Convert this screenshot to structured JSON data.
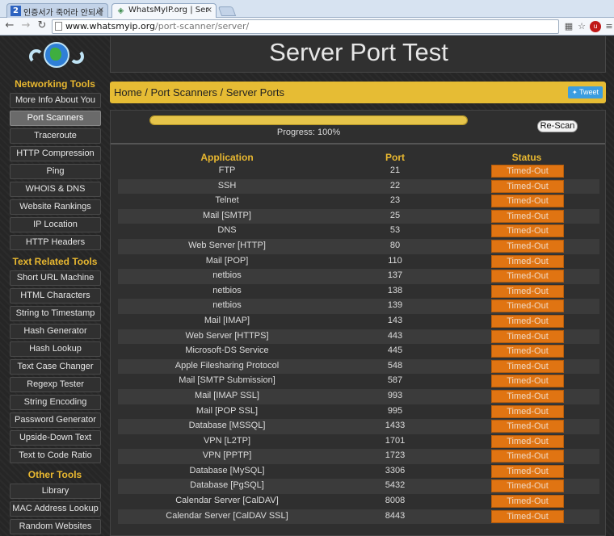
{
  "browser": {
    "tabs": [
      {
        "label": "인증서가 죽어라 안되세",
        "icon": "2",
        "active": false
      },
      {
        "label": "WhatsMyIP.org | Ser",
        "icon": "◈",
        "active": true
      }
    ],
    "url_host": "www.whatsmyip.org",
    "url_path": "/port-scanner/server/",
    "close_glyph": "×"
  },
  "sidebar": {
    "sections": [
      {
        "heading": "Networking Tools",
        "items": [
          {
            "label": "More Info About You",
            "active": false
          },
          {
            "label": "Port Scanners",
            "active": true
          },
          {
            "label": "Traceroute",
            "active": false
          },
          {
            "label": "HTTP Compression",
            "active": false
          },
          {
            "label": "Ping",
            "active": false
          },
          {
            "label": "WHOIS & DNS",
            "active": false
          },
          {
            "label": "Website Rankings",
            "active": false
          },
          {
            "label": "IP Location",
            "active": false
          },
          {
            "label": "HTTP Headers",
            "active": false
          }
        ]
      },
      {
        "heading": "Text Related Tools",
        "items": [
          {
            "label": "Short URL Machine",
            "active": false
          },
          {
            "label": "HTML Characters",
            "active": false
          },
          {
            "label": "String to Timestamp",
            "active": false
          },
          {
            "label": "Hash Generator",
            "active": false
          },
          {
            "label": "Hash Lookup",
            "active": false
          },
          {
            "label": "Text Case Changer",
            "active": false
          },
          {
            "label": "Regexp Tester",
            "active": false
          },
          {
            "label": "String Encoding",
            "active": false
          },
          {
            "label": "Password Generator",
            "active": false
          },
          {
            "label": "Upside-Down Text",
            "active": false
          },
          {
            "label": "Text to Code Ratio",
            "active": false
          }
        ]
      },
      {
        "heading": "Other Tools",
        "items": [
          {
            "label": "Library",
            "active": false
          },
          {
            "label": "MAC Address Lookup",
            "active": false
          },
          {
            "label": "Random Websites",
            "active": false
          }
        ]
      }
    ]
  },
  "header": {
    "title": "Server Port Test"
  },
  "breadcrumb": {
    "items": [
      "Home",
      "Scanners",
      "Server Ports"
    ],
    "items_full": [
      "Home",
      "Port Scanners",
      "Server Ports"
    ],
    "separator": " / ",
    "tweet_label": "Tweet"
  },
  "scan": {
    "progress_label": "Progress: 100%",
    "progress": 1.0,
    "rescan_label": "Re-Scan"
  },
  "table": {
    "headers": [
      "Application",
      "Port",
      "Status"
    ],
    "rows": [
      {
        "app": "FTP",
        "port": "21",
        "status": "Timed-Out"
      },
      {
        "app": "SSH",
        "port": "22",
        "status": "Timed-Out"
      },
      {
        "app": "Telnet",
        "port": "23",
        "status": "Timed-Out"
      },
      {
        "app": "Mail [SMTP]",
        "port": "25",
        "status": "Timed-Out"
      },
      {
        "app": "DNS",
        "port": "53",
        "status": "Timed-Out"
      },
      {
        "app": "Web Server [HTTP]",
        "port": "80",
        "status": "Timed-Out"
      },
      {
        "app": "Mail [POP]",
        "port": "110",
        "status": "Timed-Out"
      },
      {
        "app": "netbios",
        "port": "137",
        "status": "Timed-Out"
      },
      {
        "app": "netbios",
        "port": "138",
        "status": "Timed-Out"
      },
      {
        "app": "netbios",
        "port": "139",
        "status": "Timed-Out"
      },
      {
        "app": "Mail [IMAP]",
        "port": "143",
        "status": "Timed-Out"
      },
      {
        "app": "Web Server [HTTPS]",
        "port": "443",
        "status": "Timed-Out"
      },
      {
        "app": "Microsoft-DS Service",
        "port": "445",
        "status": "Timed-Out"
      },
      {
        "app": "Apple Filesharing Protocol",
        "port": "548",
        "status": "Timed-Out"
      },
      {
        "app": "Mail [SMTP Submission]",
        "port": "587",
        "status": "Timed-Out"
      },
      {
        "app": "Mail [IMAP SSL]",
        "port": "993",
        "status": "Timed-Out"
      },
      {
        "app": "Mail [POP SSL]",
        "port": "995",
        "status": "Timed-Out"
      },
      {
        "app": "Database [MSSQL]",
        "port": "1433",
        "status": "Timed-Out"
      },
      {
        "app": "VPN [L2TP]",
        "port": "1701",
        "status": "Timed-Out"
      },
      {
        "app": "VPN [PPTP]",
        "port": "1723",
        "status": "Timed-Out"
      },
      {
        "app": "Database [MySQL]",
        "port": "3306",
        "status": "Timed-Out"
      },
      {
        "app": "Database [PgSQL]",
        "port": "5432",
        "status": "Timed-Out"
      },
      {
        "app": "Calendar Server [CalDAV]",
        "port": "8008",
        "status": "Timed-Out"
      },
      {
        "app": "Calendar Server [CalDAV SSL]",
        "port": "8443",
        "status": "Timed-Out"
      }
    ]
  },
  "colors": {
    "accent_gold": "#e9b830",
    "breadcrumb_bg": "#e6bc34",
    "status_timed_out": "#e07412",
    "panel_bg": "#2f2f2f"
  }
}
